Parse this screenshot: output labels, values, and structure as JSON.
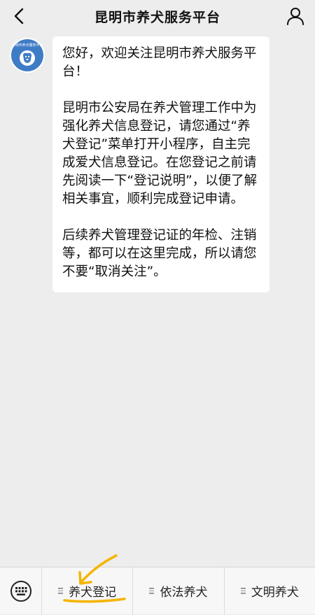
{
  "nav": {
    "title": "昆明市养犬服务平台",
    "back_icon": "chevron-left-icon",
    "profile_icon": "person-icon"
  },
  "account": {
    "avatar_text": "昆明市养犬服务平台",
    "avatar_color": "#3f7cc6"
  },
  "message": {
    "paragraphs": [
      "您好，欢迎关注昆明市养犬服务平台！",
      "昆明市公安局在养犬管理工作中为强化养犬信息登记，请您通过“养犬登记”菜单打开小程序，自主完成爱犬信息登记。在您登记之前请先阅读一下“登记说明”，以便了解相关事宜，顺利完成登记申请。",
      "后续养犬管理登记证的年检、注销等，都可以在这里完成，所以请您不要“取消关注”。"
    ]
  },
  "bottom_menu": {
    "keyboard_icon": "keyboard-icon",
    "items": [
      {
        "label": "养犬登记"
      },
      {
        "label": "依法养犬"
      },
      {
        "label": "文明养犬"
      }
    ]
  },
  "colors": {
    "background": "#ededed",
    "bubble": "#ffffff",
    "annotation": "#f5b400"
  }
}
